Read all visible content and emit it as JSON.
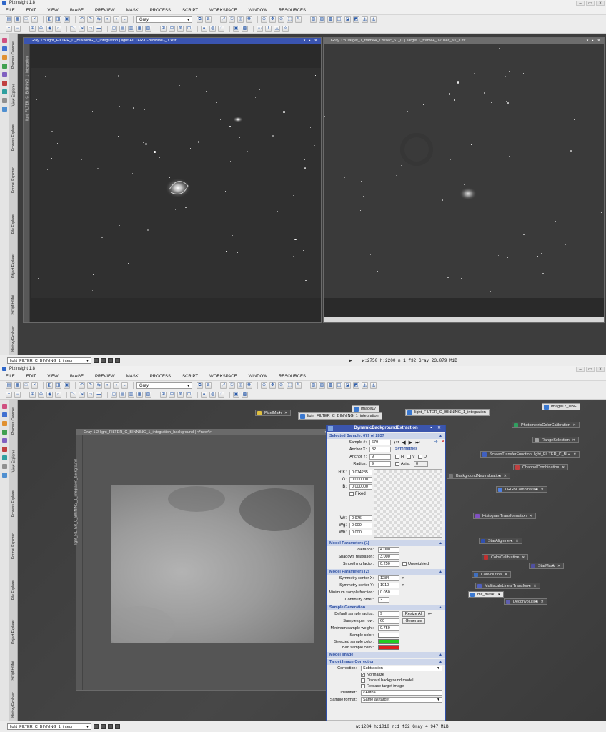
{
  "app": {
    "title": "PixInsight 1.8",
    "menus": [
      "FILE",
      "EDIT",
      "VIEW",
      "IMAGE",
      "PREVIEW",
      "MASK",
      "PROCESS",
      "SCRIPT",
      "WORKSPACE",
      "WINDOW",
      "RESOURCES"
    ],
    "channel_select": "Gray",
    "window_buttons": [
      "–",
      "▭",
      "×"
    ]
  },
  "sidetabs": [
    "Process Console",
    "View Explorer",
    "Process Explorer",
    "Format Explorer",
    "File Explorer",
    "Object Explorer",
    "Script Editor",
    "History Explorer"
  ],
  "top": {
    "window_left_title": "Gray 1:3 light_FILTER_C_BINNING_1_integration | light-FILTER-C-BINNING_1.xisf",
    "window_left_id": "light_FILTER_C_BINNING_1_integration",
    "window_right_title": "Gray 1:3 Target_1_frame4_120sec_61_C | Target 1_frame4_120sec_61_C.fit",
    "status_view": "light_FILTER_C_BINNING_1_integr",
    "status_readout": "w:2750   h:2200   n:1   f32   Gray   23.079 MiB"
  },
  "bottom": {
    "window_bg_title": "Gray 1:2 light_FILTER_C_BINNING_1_integration_background | <*new*>",
    "window_bg_id": "light_FILTER_C_BINNING_1_integration_background",
    "status_view": "light_FILTER_C_BINNING_1_integr",
    "status_readout": "w:1284   h:1010   n:1   f32   Gray   4.947 MiB",
    "top_tabs": {
      "image17": "Image17",
      "light_c": "light_FILTER_C_BINNING_1_integration",
      "light_g": "light_FILTER_G_BINNING_1_integration",
      "image17_dbe": "Image17_DBE"
    },
    "process_icons": {
      "pixelmath": "PixelMath",
      "photometric": "PhotometricColorCalibration",
      "rangeselection": "RangeSelection",
      "stf": "ScreenTransferFunction: light_FILTER_C_BI...",
      "channelcomb": "ChannelCombination",
      "bgneutral": "BackgroundNeutralization",
      "lrgb": "LRGBCombination",
      "histogram": "HistogramTransformation",
      "staralign": "StarAlignment",
      "colorcal": "ColorCalibration",
      "starmask": "StarMask",
      "convolution": "Convolution",
      "mlt": "MultiscaleLinearTransform",
      "mltmask": "mlt_mask",
      "deconv": "Deconvolution"
    },
    "dbe": {
      "title": "DynamicBackgroundExtraction",
      "selected_sample_header": "Selected Sample: 679 of 2837",
      "sample_label": "Sample #:",
      "sample_value": "679",
      "anchor_x_label": "Anchor X:",
      "anchor_x": "32",
      "anchor_y_label": "Anchor Y:",
      "anchor_y": "9",
      "radius_label": "Radius:",
      "radius": "9",
      "symmetries_label": "Symmetries",
      "sym_h": "H",
      "sym_v": "V",
      "sym_d": "D",
      "axial_label": "Axial:",
      "axial_value": "0",
      "rk_label": "R/K:",
      "rk": "0.074285",
      "g_label": "G:",
      "g": "0.000000",
      "b_label": "B:",
      "b": "0.000000",
      "fixed_label": "Fixed",
      "wr_label": "Wr:",
      "wr": "0.976",
      "wg_label": "Wg:",
      "wg": "0.000",
      "wb_label": "Wb:",
      "wb": "0.000",
      "model1_header": "Model Parameters (1)",
      "tolerance_label": "Tolerance:",
      "tolerance": "4.000",
      "shadows_label": "Shadows relaxation:",
      "shadows": "3.000",
      "smoothing_label": "Smoothing factor:",
      "smoothing": "0.250",
      "unweighted_label": "Unweighted",
      "model2_header": "Model Parameters (2)",
      "symx_label": "Symmetry center X:",
      "symx": "1284",
      "symy_label": "Symmetry center Y:",
      "symy": "1010",
      "minfrac_label": "Minimum sample fraction:",
      "minfrac": "0.050",
      "continuity_label": "Continuity order:",
      "continuity": "2",
      "samplegen_header": "Sample Generation",
      "defradius_label": "Default sample radius:",
      "defradius": "9",
      "resize_all": "Resize All",
      "samplesrow_label": "Samples per row:",
      "samplesrow": "60",
      "generate": "Generate",
      "minweight_label": "Minimum sample weight:",
      "minweight": "0.750",
      "samplecolor_label": "Sample color:",
      "selcolor_label": "Selected sample color:",
      "badcolor_label": "Bad sample color:",
      "modelimage_header": "Model Image",
      "target_header": "Target Image Correction",
      "correction_label": "Correction:",
      "correction": "Subtraction",
      "normalize_label": "Normalize",
      "discard_label": "Discard background model",
      "replace_label": "Replace target image",
      "identifier_label": "Identifier:",
      "identifier": "<Auto>",
      "sampleformat_label": "Sample format:",
      "sampleformat": "Same as target"
    }
  },
  "colors": {
    "accent": "#3b55ad",
    "sample_color": "#ffffff",
    "selected_sample_color": "#22cc22",
    "bad_sample_color": "#e02020"
  }
}
